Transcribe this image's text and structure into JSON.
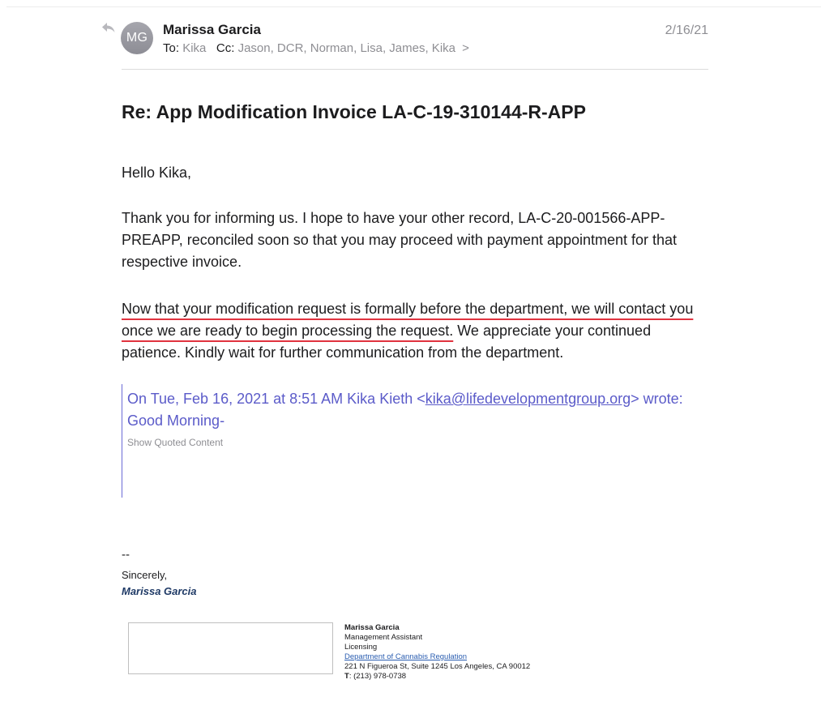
{
  "header": {
    "avatar_initials": "MG",
    "sender_name": "Marissa Garcia",
    "to_label": "To:",
    "to_value": "Kika",
    "cc_label": "Cc:",
    "cc_value": "Jason, DCR, Norman, Lisa, James, Kika",
    "cc_more": ">",
    "date": "2/16/21"
  },
  "subject": "Re: App Modification Invoice LA-C-19-310144-R-APP",
  "body": {
    "greeting": "Hello Kika,",
    "paragraph1": "Thank you for informing us. I hope to have your other record, LA-C-20-001566-APP-PREAPP, reconciled soon so that you may proceed with payment appointment for that respective invoice.",
    "paragraph2_underlined": "Now that your modification request is formally before the department, we will contact you once we are ready to begin processing the request.",
    "paragraph2_rest": " We appreciate your continued patience. Kindly wait for further communication from the department."
  },
  "quote": {
    "intro_prefix": "On Tue, Feb 16, 2021 at 8:51 AM Kika Kieth <",
    "email_link": "kika@lifedevelopmentgroup.org",
    "intro_suffix": "> wrote:",
    "first_line": "Good Morning-",
    "show_quoted": "Show Quoted Content"
  },
  "signature": {
    "dashes": "--",
    "sincerely": "Sincerely,",
    "name": "Marissa Garcia"
  },
  "card": {
    "name": "Marissa Garcia",
    "title": "Management Assistant",
    "division": "Licensing",
    "department_link": "Department of Cannabis Regulation",
    "address": "221 N Figueroa St, Suite 1245 Los Angeles, CA 90012",
    "phone_label": "T",
    "phone": ": (213) 978-0738"
  },
  "colors": {
    "link": "#5b5bc9",
    "underline_mark": "#e0333f",
    "signature_name": "#1f3a66"
  }
}
